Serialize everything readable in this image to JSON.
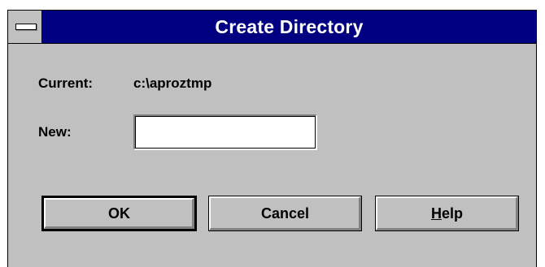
{
  "window": {
    "title": "Create Directory"
  },
  "current": {
    "label": "Current:",
    "value": "c:\\aproztmp"
  },
  "new_dir": {
    "label": "New:",
    "value": ""
  },
  "buttons": {
    "ok": "OK",
    "cancel": "Cancel",
    "help_mnemonic": "H",
    "help_rest": "elp"
  },
  "colors": {
    "titlebar": "#000080",
    "face": "#c0c0c0"
  }
}
